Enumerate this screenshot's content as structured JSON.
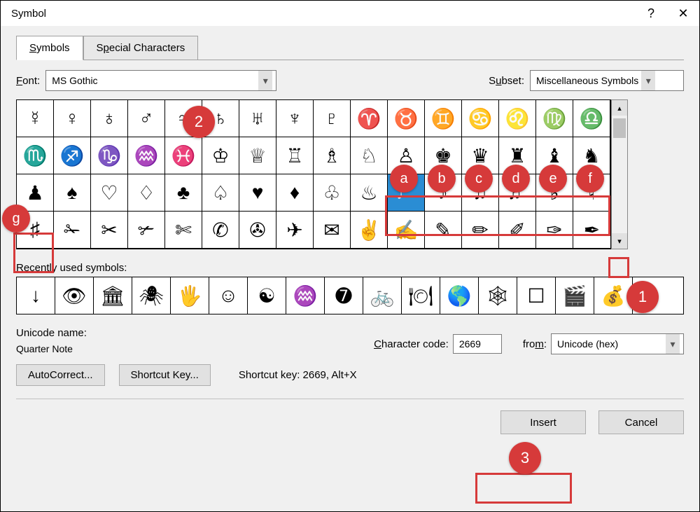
{
  "titlebar": {
    "title": "Symbol",
    "help": "?",
    "close": "✕"
  },
  "tabs": {
    "symbols": "Symbols",
    "special": "Special Characters"
  },
  "font_label": "Font:",
  "font_value": "MS Gothic",
  "subset_label": "Subset:",
  "subset_value": "Miscellaneous Symbols",
  "grid": [
    [
      "☿",
      "♀",
      "♁",
      "♂",
      "♃",
      "♄",
      "♅",
      "♆",
      "♇",
      "♈",
      "♉",
      "♊",
      "♋",
      "♌",
      "♍",
      "♎"
    ],
    [
      "♏",
      "♐",
      "♑",
      "♒",
      "♓",
      "♔",
      "♕",
      "♖",
      "♗",
      "♘",
      "♙",
      "♚",
      "♛",
      "♜",
      "♝",
      "♞"
    ],
    [
      "♟",
      "♠",
      "♡",
      "♢",
      "♣",
      "♤",
      "♥",
      "♦",
      "♧",
      "♨",
      "♩",
      "♪",
      "♫",
      "♬",
      "♭",
      "♮"
    ],
    [
      "♯",
      "✁",
      "✂",
      "✃",
      "✄",
      "✆",
      "✇",
      "✈",
      "✉",
      "✌",
      "✍",
      "✎",
      "✏",
      "✐",
      "✑",
      "✒"
    ]
  ],
  "grid_selected": {
    "row": 2,
    "col": 10
  },
  "recent_label": "Recently used symbols:",
  "recent": [
    "↓",
    "👁",
    "🏛",
    "🕷",
    "🖐",
    "☺",
    "☯",
    "♒",
    "➐",
    "🚲",
    "🍽",
    "🌎",
    "🕸",
    "☐",
    "🎬",
    "💰"
  ],
  "unicode_name_label": "Unicode name:",
  "unicode_name_value": "Quarter Note",
  "char_code_label": "Character code:",
  "char_code_value": "2669",
  "from_label": "from:",
  "from_value": "Unicode (hex)",
  "autocorrect_btn": "AutoCorrect...",
  "shortcut_btn": "Shortcut Key...",
  "shortcut_text": "Shortcut key: 2669, Alt+X",
  "insert_btn": "Insert",
  "cancel_btn": "Cancel",
  "callouts": {
    "c1": "1",
    "c2": "2",
    "c3": "3",
    "a": "a",
    "b": "b",
    "c": "c",
    "d": "d",
    "e": "e",
    "f": "f",
    "g": "g"
  }
}
